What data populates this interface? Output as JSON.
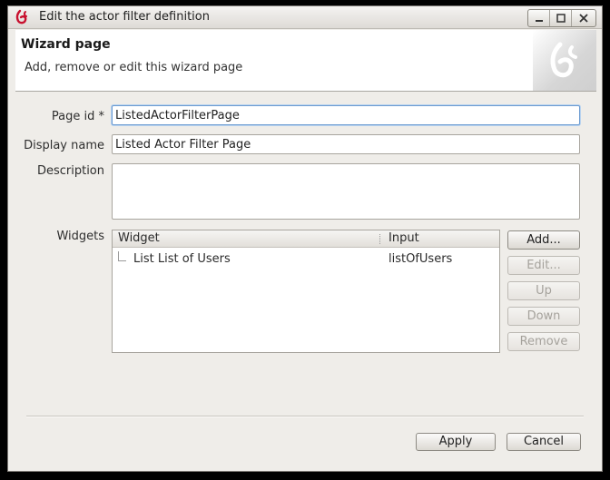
{
  "window": {
    "title": "Edit the actor filter definition",
    "controls": [
      "minimize-icon",
      "maximize-icon",
      "close-icon"
    ]
  },
  "header": {
    "title": "Wizard page",
    "subtitle": "Add, remove or edit this wizard page"
  },
  "form": {
    "page_id": {
      "label": "Page id *",
      "value": "ListedActorFilterPage"
    },
    "display_name": {
      "label": "Display name",
      "value": "Listed Actor Filter Page"
    },
    "description": {
      "label": "Description",
      "value": ""
    },
    "widgets": {
      "label": "Widgets"
    }
  },
  "table": {
    "columns": [
      "Widget",
      "Input"
    ],
    "rows": [
      {
        "widget": "List List of Users",
        "input": "listOfUsers"
      }
    ]
  },
  "side_buttons": {
    "add": "Add...",
    "edit": "Edit...",
    "up": "Up",
    "down": "Down",
    "remove": "Remove"
  },
  "footer": {
    "apply": "Apply",
    "cancel": "Cancel"
  },
  "colors": {
    "logo_red": "#c8102e",
    "focus_blue": "#6b9bd1"
  }
}
